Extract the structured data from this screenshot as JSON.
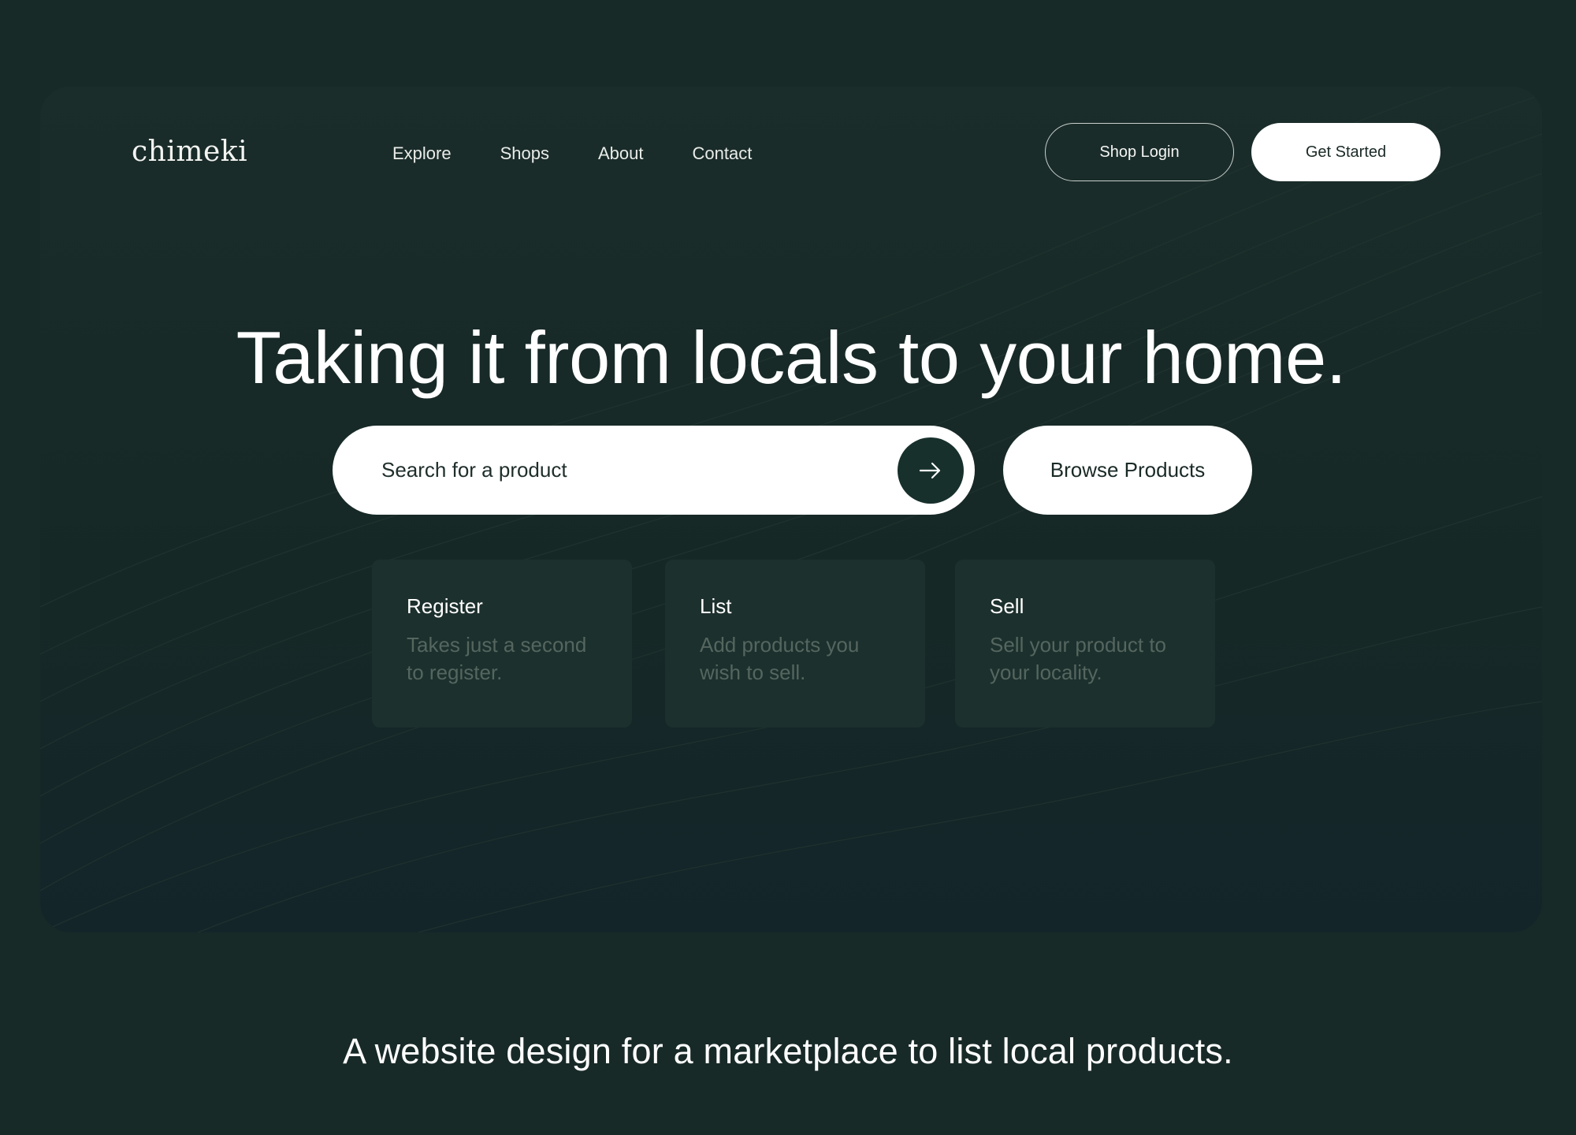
{
  "brand": {
    "logo": "chimeki"
  },
  "nav": {
    "items": [
      {
        "label": "Explore"
      },
      {
        "label": "Shops"
      },
      {
        "label": "About"
      },
      {
        "label": "Contact"
      }
    ],
    "shop_login_label": "Shop Login",
    "get_started_label": "Get Started"
  },
  "hero": {
    "headline": "Taking it from locals to your home.",
    "search_placeholder": "Search for a product",
    "search_icon": "arrow-right-icon",
    "browse_label": "Browse Products"
  },
  "steps": [
    {
      "title": "Register",
      "description": "Takes just a second to register."
    },
    {
      "title": "List",
      "description": "Add products you wish to sell."
    },
    {
      "title": "Sell",
      "description": "Sell your product to your locality."
    }
  ],
  "caption": "A website design for a marketplace to list local products.",
  "colors": {
    "background": "#182a28",
    "panel": "#1a2d2a",
    "card": "#1c302d",
    "accent_dark": "#17302c",
    "muted_text": "#55665f",
    "white": "#ffffff"
  }
}
